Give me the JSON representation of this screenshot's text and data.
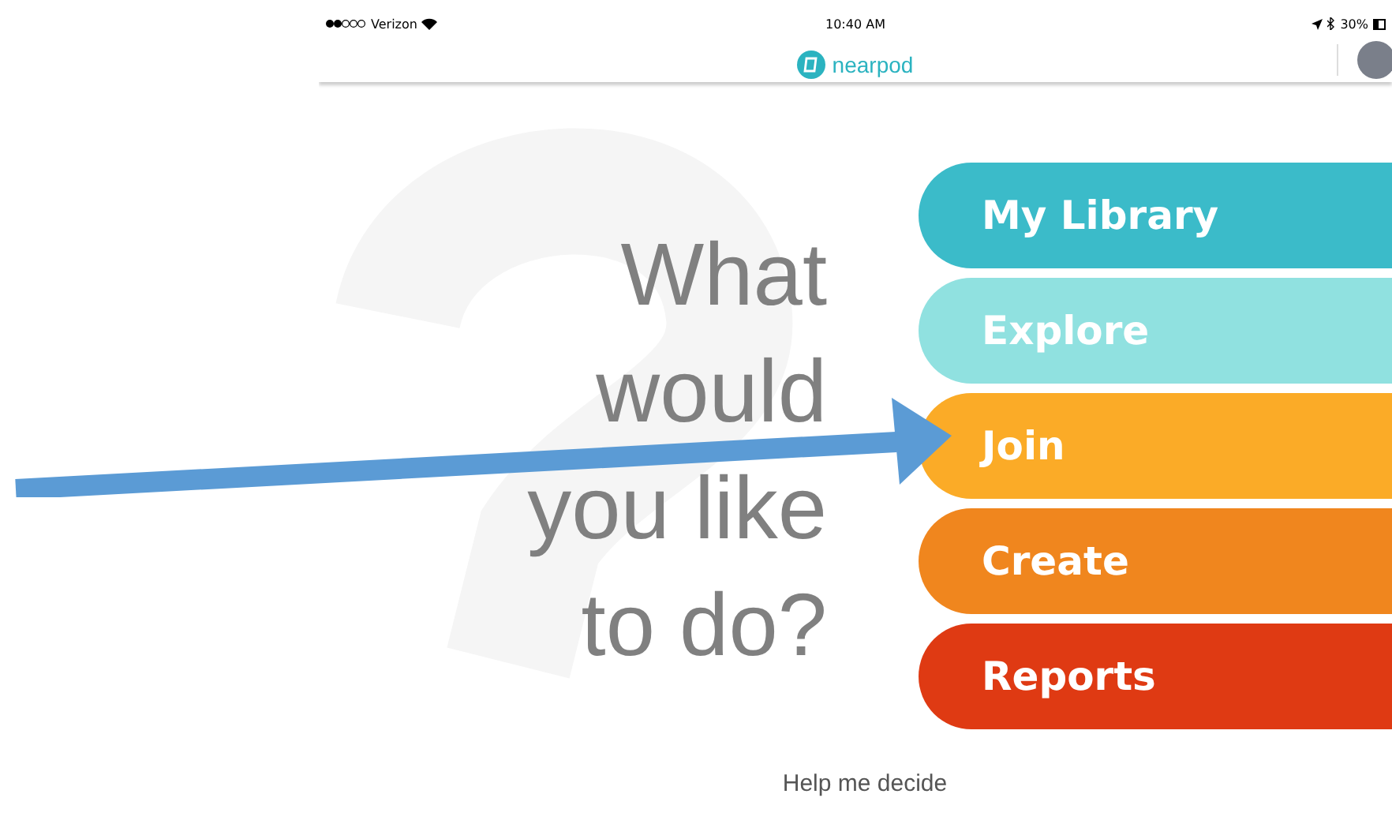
{
  "status_bar": {
    "carrier": "Verizon",
    "time": "10:40 AM",
    "battery": "30%"
  },
  "header": {
    "logo": "nearpod"
  },
  "prompt": [
    "What",
    "would",
    "you like",
    "to do?"
  ],
  "options": [
    {
      "label": "My Library",
      "color": "#3bbbc9"
    },
    {
      "label": "Explore",
      "color": "#90e1e0"
    },
    {
      "label": "Join",
      "color": "#fbab27"
    },
    {
      "label": "Create",
      "color": "#f0861e"
    },
    {
      "label": "Reports",
      "color": "#df3a13"
    }
  ],
  "help_link": "Help me decide"
}
